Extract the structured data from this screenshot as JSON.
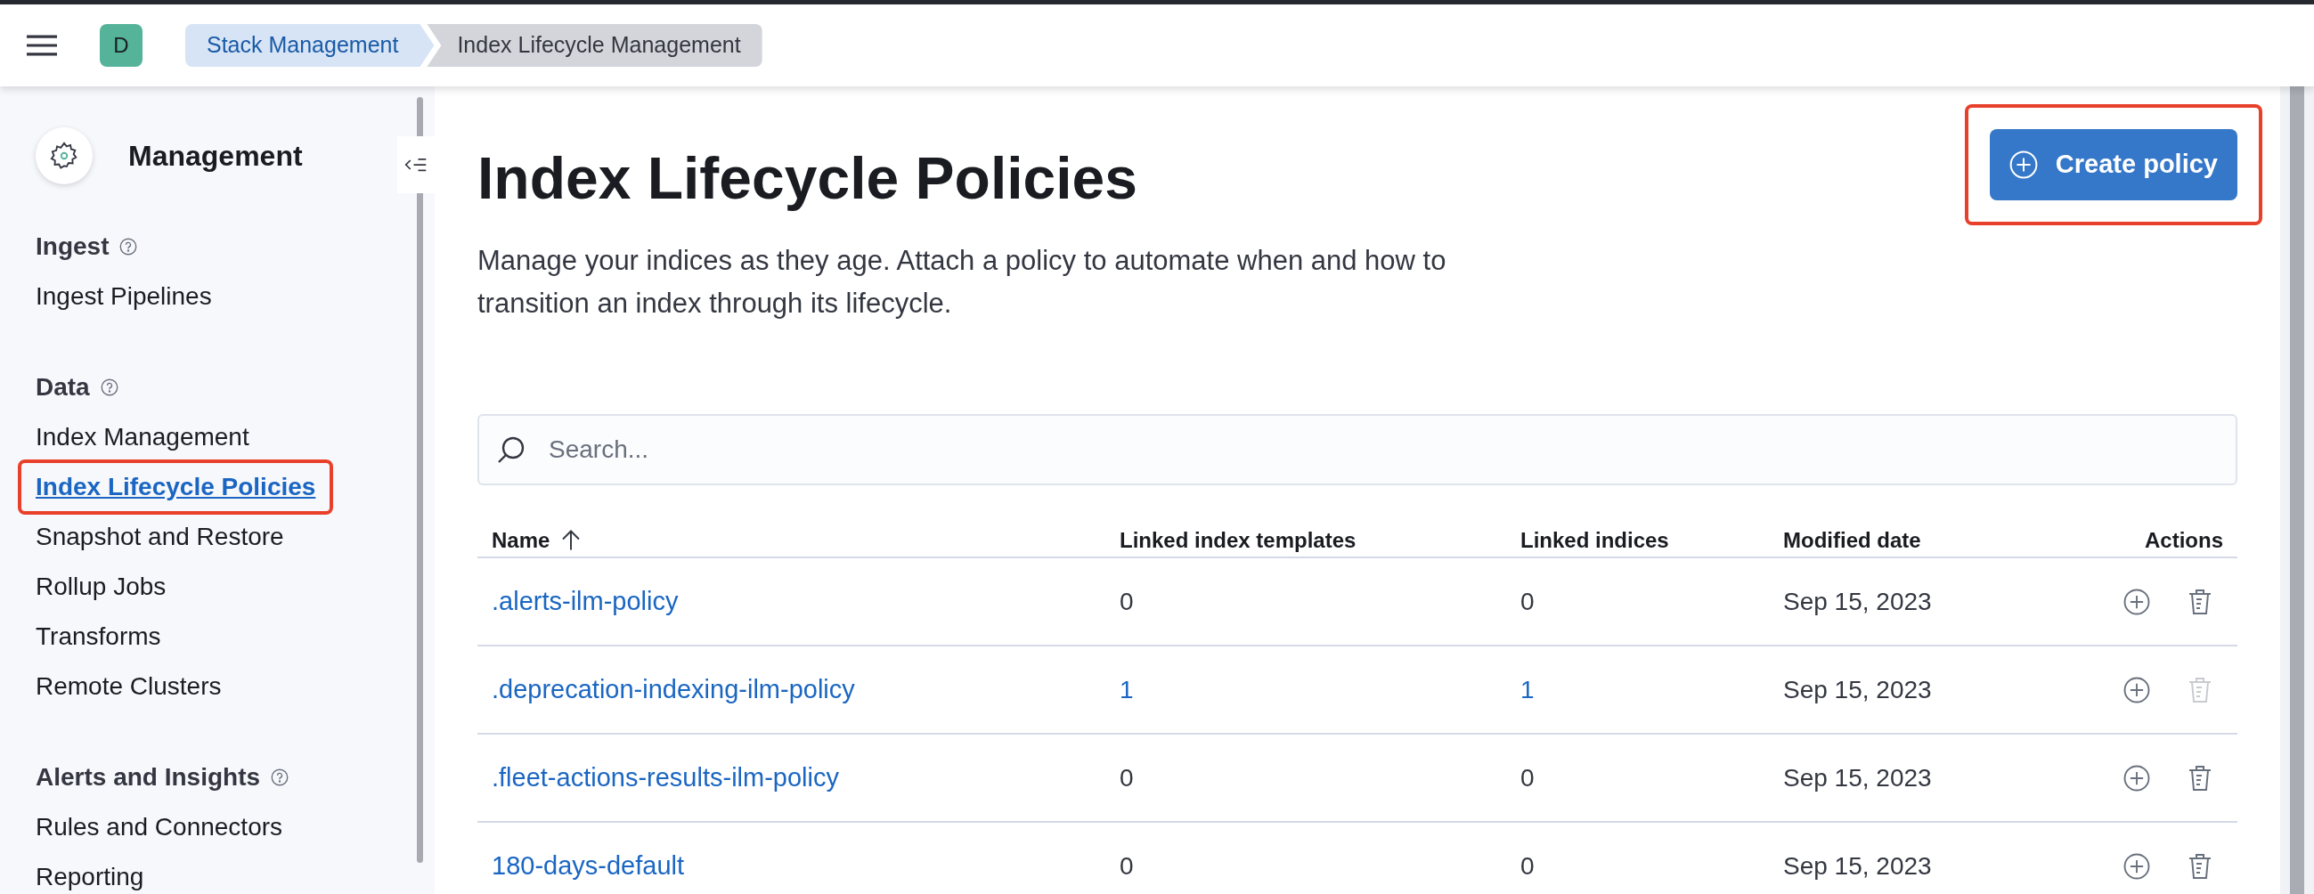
{
  "header": {
    "avatar": "D",
    "breadcrumbs": [
      {
        "label": "Stack Management",
        "selected": false
      },
      {
        "label": "Index Lifecycle Management",
        "selected": true
      }
    ]
  },
  "sidebar": {
    "title": "Management",
    "sections": [
      {
        "heading": "Ingest",
        "items": [
          {
            "label": "Ingest Pipelines",
            "selected": false,
            "highlighted": false
          }
        ]
      },
      {
        "heading": "Data",
        "items": [
          {
            "label": "Index Management",
            "selected": false,
            "highlighted": false
          },
          {
            "label": "Index Lifecycle Policies",
            "selected": true,
            "highlighted": true
          },
          {
            "label": "Snapshot and Restore",
            "selected": false,
            "highlighted": false
          },
          {
            "label": "Rollup Jobs",
            "selected": false,
            "highlighted": false
          },
          {
            "label": "Transforms",
            "selected": false,
            "highlighted": false
          },
          {
            "label": "Remote Clusters",
            "selected": false,
            "highlighted": false
          }
        ]
      },
      {
        "heading": "Alerts and Insights",
        "items": [
          {
            "label": "Rules and Connectors",
            "selected": false,
            "highlighted": false
          },
          {
            "label": "Reporting",
            "selected": false,
            "highlighted": false
          }
        ]
      }
    ]
  },
  "page": {
    "title": "Index Lifecycle Policies",
    "description": "Manage your indices as they age. Attach a policy to automate when and how to transition an index through its lifecycle.",
    "create_button": {
      "label": "Create policy",
      "highlighted": true
    },
    "search": {
      "placeholder": "Search..."
    }
  },
  "table": {
    "columns": [
      {
        "label": "Name",
        "sorted": true
      },
      {
        "label": "Linked index templates",
        "sorted": false
      },
      {
        "label": "Linked indices",
        "sorted": false
      },
      {
        "label": "Modified date",
        "sorted": false
      },
      {
        "label": "Actions",
        "sorted": false
      }
    ],
    "rows": [
      {
        "name": ".alerts-ilm-policy",
        "templates": {
          "text": "0",
          "link": false
        },
        "indices": {
          "text": "0",
          "link": false
        },
        "modified": "Sep 15, 2023",
        "delete_disabled": false
      },
      {
        "name": ".deprecation-indexing-ilm-policy",
        "templates": {
          "text": "1",
          "link": true
        },
        "indices": {
          "text": "1",
          "link": true
        },
        "modified": "Sep 15, 2023",
        "delete_disabled": true
      },
      {
        "name": ".fleet-actions-results-ilm-policy",
        "templates": {
          "text": "0",
          "link": false
        },
        "indices": {
          "text": "0",
          "link": false
        },
        "modified": "Sep 15, 2023",
        "delete_disabled": false
      },
      {
        "name": "180-days-default",
        "templates": {
          "text": "0",
          "link": false
        },
        "indices": {
          "text": "0",
          "link": false
        },
        "modified": "Sep 15, 2023",
        "delete_disabled": false
      }
    ]
  }
}
